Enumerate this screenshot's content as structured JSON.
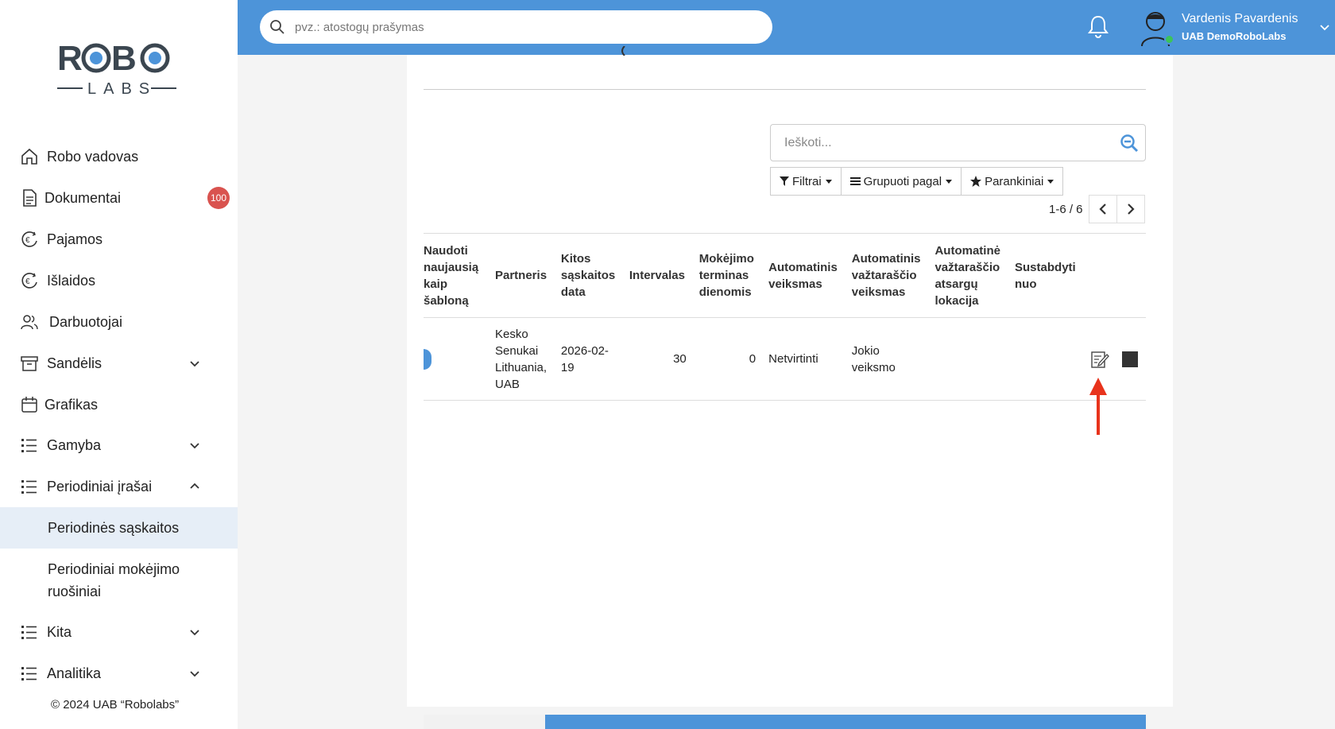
{
  "brand": {
    "logo_top": "ROBO",
    "logo_bottom": "LABS"
  },
  "topbar": {
    "search_placeholder": "pvz.: atostogų prašymas",
    "user_name": "Vardenis Pavardenis",
    "user_company": "UAB DemoRoboLabs"
  },
  "sidebar": {
    "items": [
      {
        "label": "Robo vadovas",
        "icon": "home-icon"
      },
      {
        "label": "Dokumentai",
        "icon": "document-icon",
        "badge": "100"
      },
      {
        "label": "Pajamos",
        "icon": "euro-income-icon"
      },
      {
        "label": "Išlaidos",
        "icon": "euro-expense-icon"
      },
      {
        "label": "Darbuotojai",
        "icon": "users-icon"
      },
      {
        "label": "Sandėlis",
        "icon": "archive-icon"
      },
      {
        "label": "Grafikas",
        "icon": "calendar-icon"
      },
      {
        "label": "Gamyba",
        "icon": "list-icon"
      },
      {
        "label": "Periodiniai įrašai",
        "icon": "list-icon"
      },
      {
        "label": "Kita",
        "icon": "list-icon"
      },
      {
        "label": "Analitika",
        "icon": "list-icon"
      }
    ],
    "subitems": [
      {
        "label": "Periodinės sąskaitos",
        "active": true
      },
      {
        "label": "Periodiniai mokėjimo ruošiniai",
        "active": false
      }
    ],
    "copyright": "© 2024 UAB “Robolabs”"
  },
  "list": {
    "search_placeholder": "Ieškoti...",
    "filters_label": "Filtrai",
    "group_label": "Grupuoti pagal",
    "favorites_label": "Parankiniai",
    "pager_text": "1-6 / 6",
    "columns": [
      "Naudoti naujausią kaip šabloną",
      "Partneris",
      "Kitos sąskaitos data",
      "Intervalas",
      "Mokėjimo terminas dienomis",
      "Automatinis veiksmas",
      "Automatinis važtaraščio veiksmas",
      "Automatinė važtaraščio atsargų lokacija",
      "Sustabdyti nuo"
    ],
    "rows": [
      {
        "partner": "Kesko Senukai Lithuania, UAB",
        "next_date": "2026-02-19",
        "interval": "30",
        "term_days": "0",
        "auto_action": "Netvirtinti",
        "auto_waybill_action": "Jokio veiksmo",
        "waybill_location": "",
        "stop_from": ""
      }
    ]
  },
  "colors": {
    "primary": "#4d94d9",
    "badge": "#d9534f",
    "arrow": "#e8331c",
    "online": "#3cc35a"
  }
}
